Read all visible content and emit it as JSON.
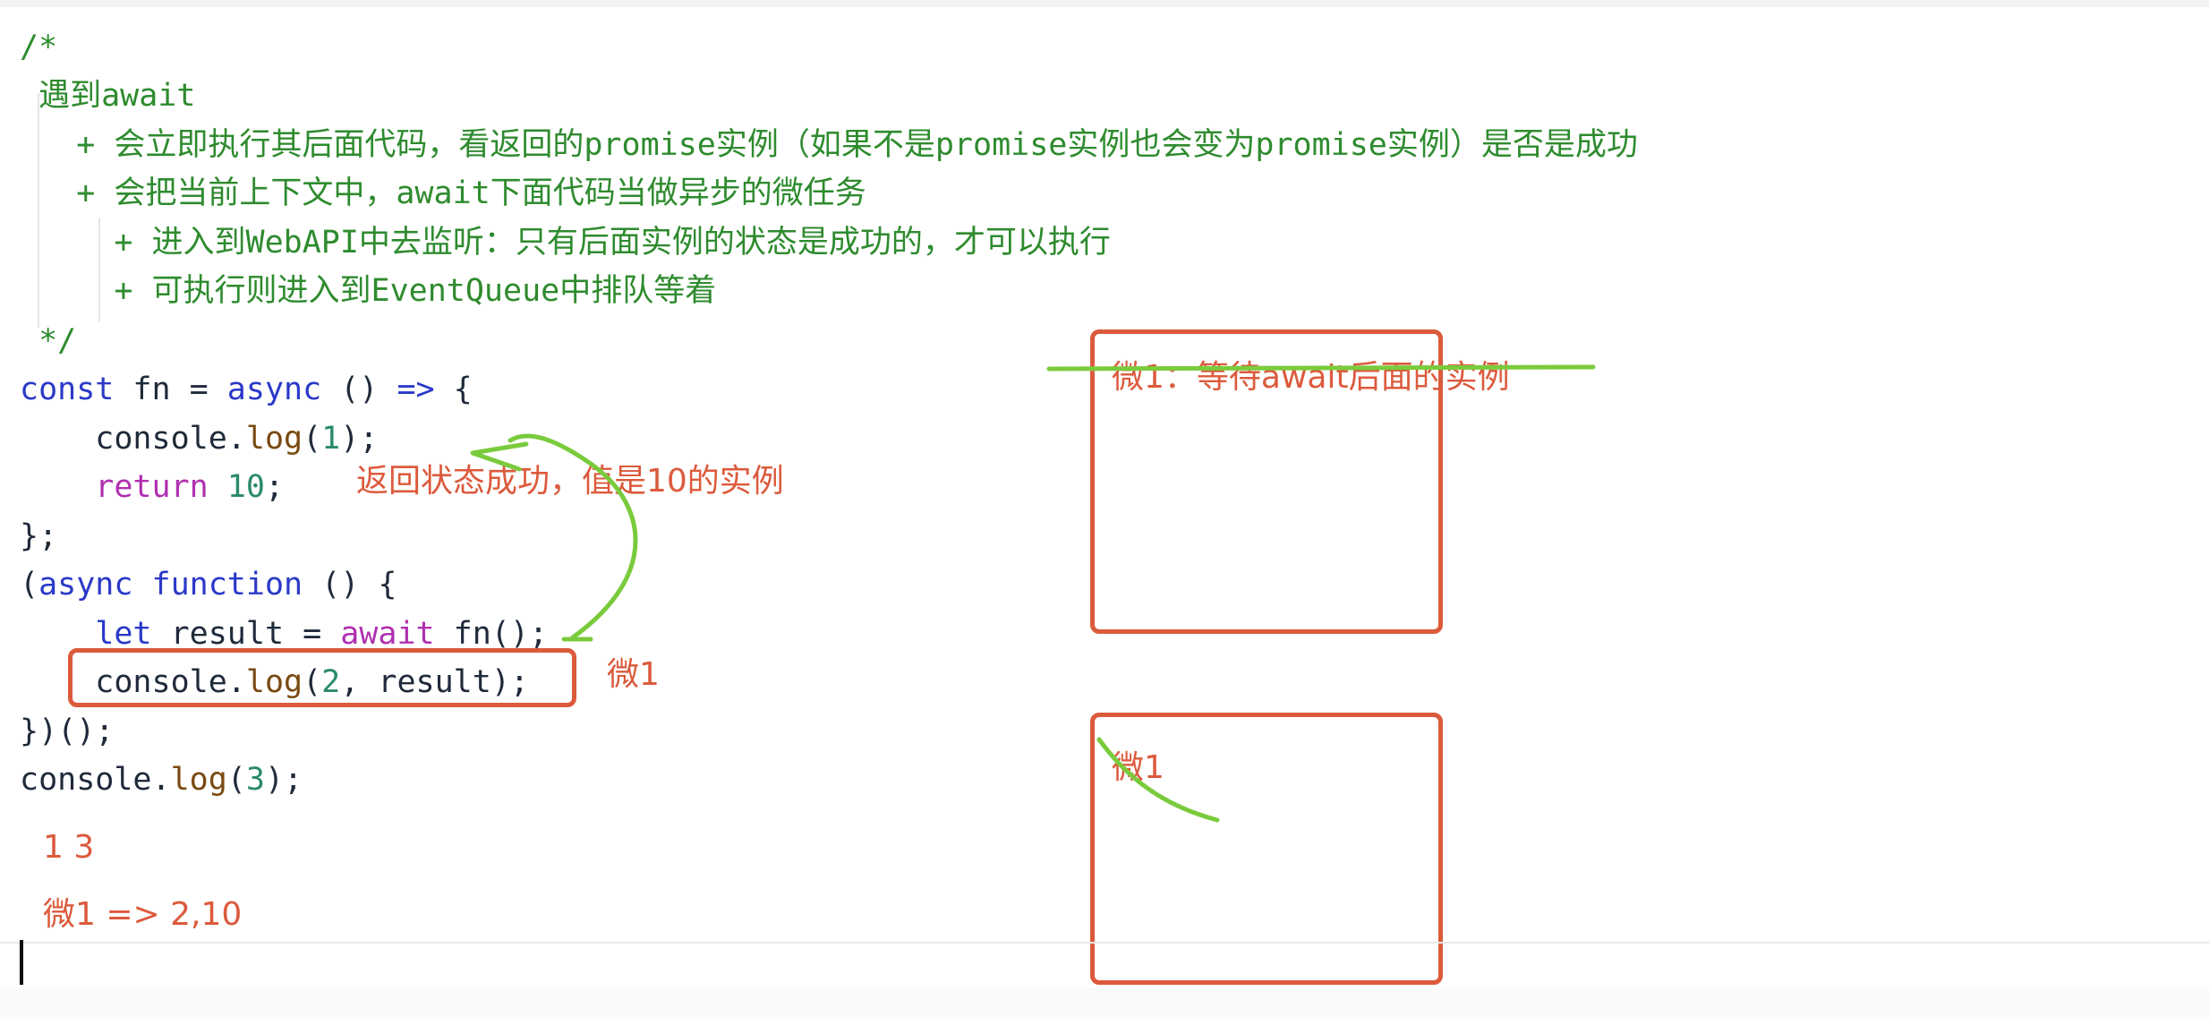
{
  "code": {
    "comment_open": "/*",
    "comment_line1": " 遇到await",
    "comment_line2": "   + 会立即执行其后面代码，看返回的promise实例（如果不是promise实例也会变为promise实例）是否是成功",
    "comment_line3": "   + 会把当前上下文中，await下面代码当做异步的微任务",
    "comment_line4": "     + 进入到WebAPI中去监听：只有后面实例的状态是成功的，才可以执行",
    "comment_line5": "     + 可执行则进入到EventQueue中排队等着",
    "comment_close": " */",
    "l1_const": "const",
    "l1_fn": " fn = ",
    "l1_async": "async",
    "l1_paren": " () ",
    "l1_arrow": "=>",
    "l1_brace": " {",
    "l2_console": "    console.",
    "l2_log": "log",
    "l2_open": "(",
    "l2_num": "1",
    "l2_close": ");",
    "l3_return": "    return",
    "l3_space": " ",
    "l3_num": "10",
    "l3_semi": ";",
    "l4": "};",
    "l5_paren": "(",
    "l5_async": "async",
    "l5_space": " ",
    "l5_function": "function",
    "l5_rest": " () {",
    "l6_let": "    let",
    "l6_mid": " result = ",
    "l6_await": "await",
    "l6_call": " fn();",
    "l7_console": "    console.",
    "l7_log": "log",
    "l7_open": "(",
    "l7_num": "2",
    "l7_rest": ", result);",
    "l8": "})();",
    "l9_console": "console.",
    "l9_log": "log",
    "l9_open": "(",
    "l9_num": "3",
    "l9_close": ");"
  },
  "annotations": {
    "return_note": "返回状态成功，值是10的实例",
    "micro_label": "微1",
    "webapi_note": "微1：等待await后面的实例",
    "queue_note": "微1",
    "output_line1": "1   3",
    "output_line2": "微1 => 2,10"
  },
  "colors": {
    "comment": "#2e8b2e",
    "keyword": "#2a39c8",
    "keyword_control": "#b030b0",
    "number": "#2a8a6a",
    "annotation_red": "#dc5a3c",
    "annotation_green": "#7acb3c"
  }
}
